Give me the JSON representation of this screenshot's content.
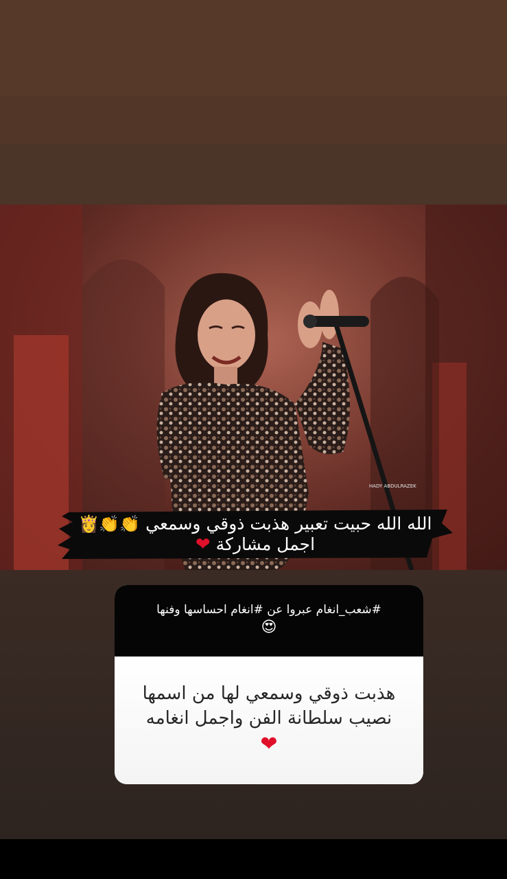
{
  "story": {
    "photo": {
      "watermark": "HADY ABDULRAZEK"
    },
    "caption": {
      "line1_text": "الله الله حبيت تعبير هذبت ذوقي وسمعي",
      "line1_emojis": "👏👏👸",
      "line2_text": "اجمل مشاركة",
      "line2_emoji": "❤"
    },
    "question_box": {
      "question": "#شعب_انغام عبروا عن #انغام احساسها وفنها",
      "question_emoji": "😍",
      "answer_line1": "هذبت ذوقي وسمعي لها من اسمها",
      "answer_line2": "نصيب سلطانة الفن واجمل انغامه",
      "answer_emoji": "❤"
    },
    "colors": {
      "background_top": "#57392a",
      "background_bottom": "#2d2420",
      "heart": "#e0102a",
      "question_header": "#050505",
      "answer_card": "#ffffff"
    }
  }
}
